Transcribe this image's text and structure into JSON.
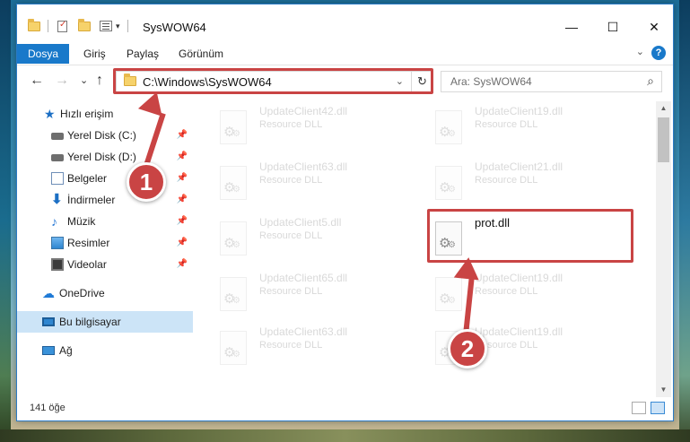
{
  "window": {
    "title": "SysWOW64",
    "minimize": "—",
    "maximize": "☐",
    "close": "✕"
  },
  "ribbon": {
    "tabs": [
      "Dosya",
      "Giriş",
      "Paylaş",
      "Görünüm"
    ],
    "expand": "⌄",
    "help": "?"
  },
  "nav": {
    "back": "←",
    "forward": "→",
    "recent": "⌄",
    "up": "↑",
    "address": "C:\\Windows\\SysWOW64",
    "address_drop": "⌄",
    "refresh": "↻",
    "search_placeholder": "Ara: SysWOW64",
    "search_icon": "⌕"
  },
  "sidebar": {
    "items": [
      {
        "label": "Hızlı erişim",
        "icon": "star-icon"
      },
      {
        "label": "Yerel Disk (C:)",
        "icon": "drive-icon",
        "pinned": true
      },
      {
        "label": "Yerel Disk (D:)",
        "icon": "drive-icon",
        "pinned": true
      },
      {
        "label": "Belgeler",
        "icon": "documents-icon",
        "pinned": true
      },
      {
        "label": "İndirmeler",
        "icon": "download-icon",
        "pinned": true
      },
      {
        "label": "Müzik",
        "icon": "music-icon",
        "pinned": true
      },
      {
        "label": "Resimler",
        "icon": "pictures-icon",
        "pinned": true
      },
      {
        "label": "Videolar",
        "icon": "videos-icon",
        "pinned": true
      },
      {
        "label": "OneDrive",
        "icon": "onedrive-icon"
      },
      {
        "label": "Bu bilgisayar",
        "icon": "pc-icon",
        "selected": true
      },
      {
        "label": "Ağ",
        "icon": "network-icon"
      }
    ],
    "pin_glyph": "📌"
  },
  "files": [
    {
      "name": "UpdateClient42.dll",
      "type": "Resource DLL"
    },
    {
      "name": "UpdateClient19.dll",
      "type": "Resource DLL"
    },
    {
      "name": "UpdateClient63.dll",
      "type": "Resource DLL"
    },
    {
      "name": "UpdateClient21.dll",
      "type": "Resource DLL"
    },
    {
      "name": "UpdateClient5.dll",
      "type": "Resource DLL"
    },
    {
      "name": "prot.dll",
      "type": ""
    },
    {
      "name": "UpdateClient65.dll",
      "type": "Resource DLL"
    },
    {
      "name": "UpdateClient19.dll",
      "type": "Resource DLL"
    },
    {
      "name": "UpdateClient63.dll",
      "type": "Resource DLL"
    },
    {
      "name": "UpdateClient19.dll",
      "type": "Resource DLL"
    }
  ],
  "status": {
    "count": "141 öğe"
  },
  "callouts": {
    "step1": "1",
    "step2": "2"
  },
  "colors": {
    "accent": "#1979ca",
    "highlight": "#c94444",
    "selection": "#cce4f7"
  }
}
